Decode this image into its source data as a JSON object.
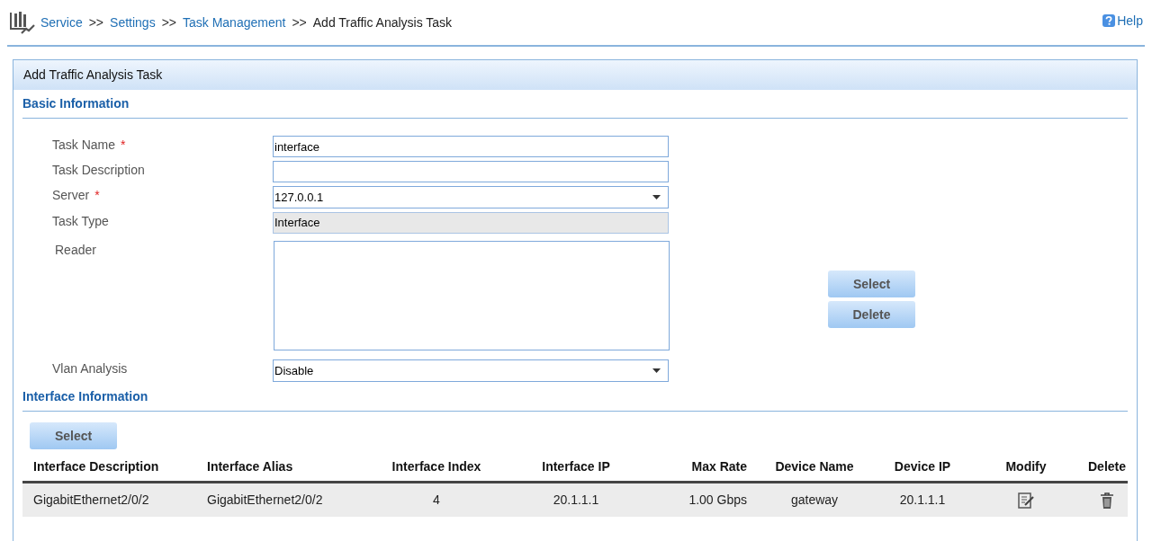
{
  "breadcrumb": [
    {
      "label": "Service",
      "link": true
    },
    {
      "label": "Settings",
      "link": true
    },
    {
      "label": "Task Management",
      "link": true
    },
    {
      "label": "Add Traffic Analysis Task",
      "link": false
    }
  ],
  "breadcrumb_separator": ">>",
  "required_mark": "*",
  "help": "Help",
  "panel": {
    "title": "Add Traffic Analysis Task"
  },
  "basic_section": {
    "title": "Basic Information",
    "fields": [
      {
        "label": "Task Name",
        "required": true,
        "kind": "text",
        "value": "interface"
      },
      {
        "label": "Task Description",
        "required": false,
        "kind": "text"
      },
      {
        "label": "Server",
        "required": true,
        "kind": "select",
        "value": "127.0.0.1"
      },
      {
        "label": "Task Type",
        "required": false,
        "kind": "readonly",
        "value": "Interface"
      },
      {
        "label": "Reader",
        "required": false,
        "kind": "textarea"
      },
      {
        "label": "Vlan Analysis",
        "required": false,
        "kind": "select",
        "value": "Disable"
      }
    ],
    "reader_buttons": [
      "Select",
      "Delete"
    ]
  },
  "interface_section": {
    "title": "Interface Information",
    "button": "Select",
    "table": {
      "columns": [
        "Interface Description",
        "Interface Alias",
        "Interface Index",
        "Interface IP",
        "Max Rate",
        "Device Name",
        "Device IP",
        "Modify",
        "Delete"
      ],
      "rows": [
        {
          "cells": [
            "GigabitEthernet2/0/2",
            "GigabitEthernet2/0/2",
            "4",
            "20.1.1.1",
            "1.00 Gbps",
            "gateway",
            "20.1.1.1"
          ]
        }
      ]
    }
  }
}
